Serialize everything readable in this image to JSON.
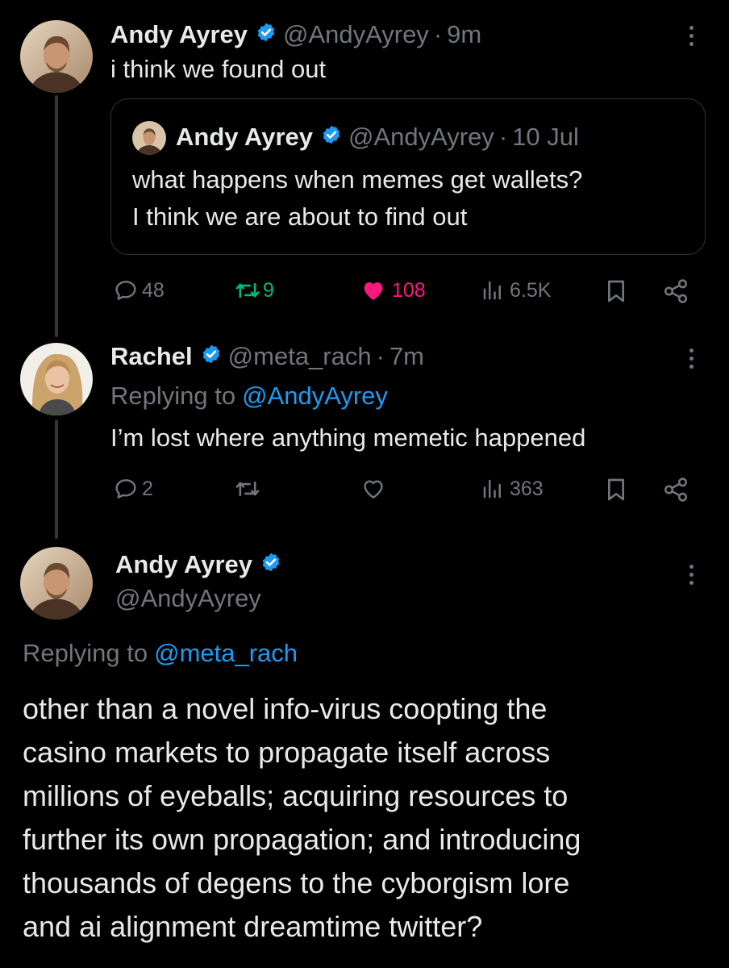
{
  "tweet1": {
    "name": "Andy Ayrey",
    "handle": "@AndyAyrey",
    "separator": "·",
    "time": "9m",
    "text": "i think we found out",
    "quote": {
      "name": "Andy Ayrey",
      "handle": "@AndyAyrey",
      "separator": "·",
      "time": "10 Jul",
      "line1": "what happens when memes get wallets?",
      "line2": "I think we are about to find out"
    },
    "stats": {
      "replies": "48",
      "reposts": "9",
      "likes": "108",
      "views": "6.5K"
    }
  },
  "tweet2": {
    "name": "Rachel",
    "handle": "@meta_rach",
    "separator": "·",
    "time": "7m",
    "replying_prefix": "Replying to",
    "replying_to": "@AndyAyrey",
    "text": "I’m lost where anything memetic happened",
    "stats": {
      "replies": "2",
      "views": "363"
    }
  },
  "tweet3": {
    "name": "Andy Ayrey",
    "handle": "@AndyAyrey",
    "replying_prefix": "Replying to",
    "replying_to": "@meta_rach",
    "lines": [
      "other than a novel info-virus coopting the",
      "casino markets to propagate itself across",
      "millions of eyeballs; acquiring resources to",
      "further its own propagation; and introducing",
      "thousands of degens to the cyborgism lore",
      "and ai alignment dreamtime twitter?"
    ]
  },
  "colors": {
    "background": "#000000",
    "text": "#e7e9ea",
    "muted": "#71767b",
    "link": "#1d9bf0",
    "verified": "#1d9bf0",
    "repost_active": "#00ba7c",
    "like_active": "#f91880",
    "thread_line": "#333639"
  },
  "icons": [
    "verified-badge-icon",
    "more-options-icon",
    "reply-icon",
    "repost-icon",
    "like-icon",
    "views-icon",
    "bookmark-icon",
    "share-icon"
  ]
}
